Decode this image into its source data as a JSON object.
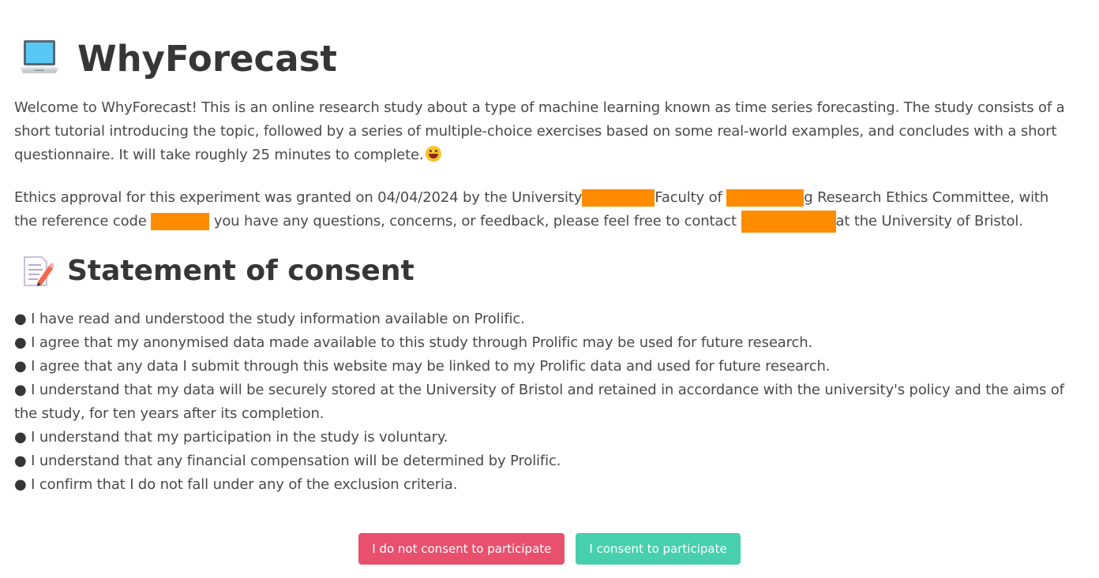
{
  "app": {
    "title": "WhyForecast",
    "title_icon": "laptop-icon"
  },
  "intro": {
    "text": "Welcome to WhyForecast! This is an online research study about a type of machine learning known as time series forecasting. The study consists of a short tutorial introducing the topic, followed by a series of multiple-choice exercises based on some real-world examples, and concludes with a short questionnaire. It will take roughly 25 minutes to complete.",
    "emoji": "grinning-face-icon"
  },
  "ethics": {
    "part1": "Ethics approval for this experiment was granted on 04/04/2024 by the University",
    "part2": "Faculty of",
    "part3": "g Research Ethics Committee, with the reference code",
    "part4": "you have any questions, concerns, or feedback, please feel free to contact",
    "part5": "at the University of Bristol.",
    "redaction_color": "#ff8c00"
  },
  "consent": {
    "title": "Statement of consent",
    "title_icon": "memo-icon",
    "bullet": "●",
    "items": [
      "I have read and understood the study information available on Prolific.",
      "I agree that my anonymised data made available to this study through Prolific may be used for future research.",
      "I agree that any data I submit through this website may be linked to my Prolific data and used for future research.",
      "I understand that my data will be securely stored at the University of Bristol and retained in accordance with the university's policy and the aims of the study, for ten years after its completion.",
      "I understand that my participation in the study is voluntary.",
      "I understand that any financial compensation will be determined by Prolific.",
      "I confirm that I do not fall under any of the exclusion criteria."
    ]
  },
  "buttons": {
    "decline_label": "I do not consent to participate",
    "accept_label": "I consent to participate",
    "decline_color": "#e8506e",
    "accept_color": "#48cfae"
  }
}
